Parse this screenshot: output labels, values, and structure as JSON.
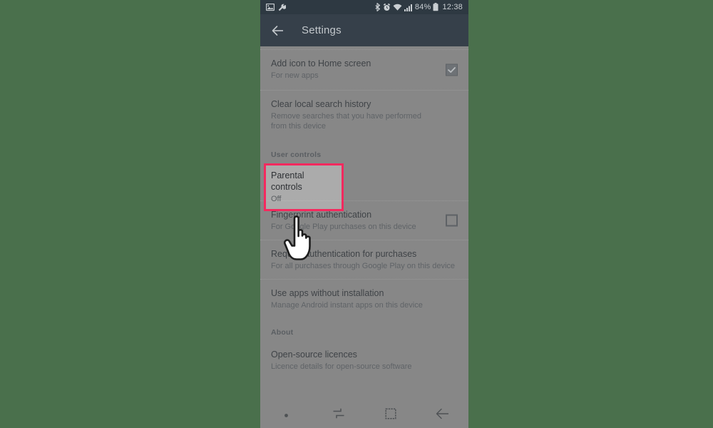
{
  "background": {
    "color": "#4a704c"
  },
  "phone": {
    "status_bar": {
      "left_icons": [
        "screenshot-icon",
        "wrench-icon"
      ],
      "right_icons": [
        "bluetooth-icon",
        "alarm-icon",
        "wifi-icon",
        "signal-icon"
      ],
      "battery_percent": "84%",
      "battery_icon": "battery-icon",
      "clock": "12:38"
    },
    "app_bar": {
      "back_icon": "back-arrow-icon",
      "title": "Settings"
    },
    "list": {
      "rows": [
        {
          "id": "add-icon-to-home-screen",
          "title": "Add icon to Home screen",
          "subtitle": "For new apps",
          "control": "checkbox",
          "checked": true
        },
        {
          "id": "clear-local-search-history",
          "title": "Clear local search history",
          "subtitle": "Remove searches that you have performed from this device",
          "control": "none",
          "checked": false
        },
        {
          "id": "parental-controls",
          "title": "Parental controls",
          "subtitle": "Off",
          "control": "none",
          "checked": false,
          "highlighted": true
        },
        {
          "id": "fingerprint-authentication",
          "title": "Fingerprint authentication",
          "subtitle": "For Google Play purchases on this device",
          "control": "checkbox",
          "checked": false
        },
        {
          "id": "require-authentication-for-purchases",
          "title": "Require authentication for purchases",
          "subtitle": "For all purchases through Google Play on this device",
          "control": "none",
          "checked": false
        },
        {
          "id": "use-apps-without-installation",
          "title": "Use apps without installation",
          "subtitle": "Manage Android instant apps on this device",
          "control": "none",
          "checked": false
        },
        {
          "id": "open-source-licences",
          "title": "Open-source licences",
          "subtitle": "Licence details for open-source software",
          "control": "none",
          "checked": false
        }
      ],
      "sections": {
        "user_controls": "User controls",
        "about": "About"
      }
    },
    "nav_bar": {
      "items": [
        "dot-indicator-icon",
        "recents-icon",
        "home-icon",
        "back-icon"
      ]
    }
  },
  "highlight": {
    "border_color": "#f5295e",
    "target": "parental-controls"
  },
  "cursor": {
    "type": "pointing-hand-cursor"
  }
}
